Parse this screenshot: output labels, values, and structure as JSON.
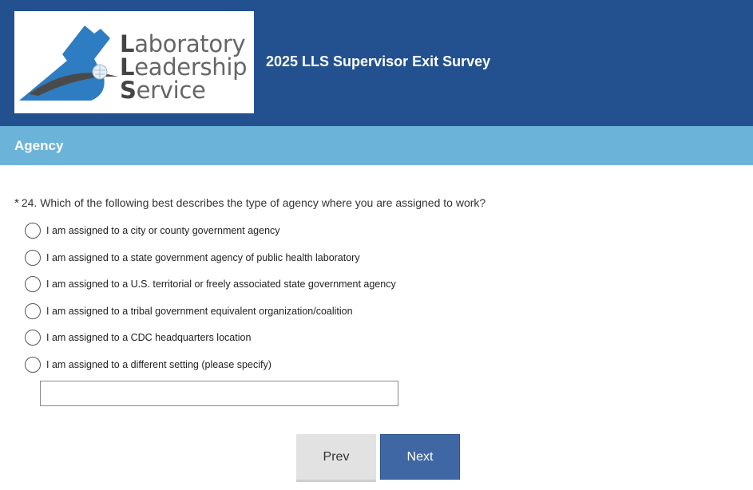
{
  "header": {
    "logo": {
      "line1_initial": "L",
      "line1_rest": "aboratory",
      "line2_initial": "L",
      "line2_rest": "eadership",
      "line3_initial": "S",
      "line3_rest": "ervice"
    },
    "survey_title": "2025 LLS Supervisor Exit Survey",
    "background_color": "#23518f"
  },
  "section": {
    "title": "Agency",
    "background_color": "#6cb3da"
  },
  "question": {
    "required_marker": "*",
    "text": "24. Which of the following best describes the type of agency where you are assigned to work?",
    "options": [
      {
        "label": "I am assigned to a city or county government agency",
        "selected": false
      },
      {
        "label": "I am assigned to a state government agency of public health laboratory",
        "selected": false
      },
      {
        "label": "I am assigned to a U.S. territorial or freely associated state government agency",
        "selected": false
      },
      {
        "label": "I am assigned to a tribal government equivalent organization/coalition",
        "selected": false
      },
      {
        "label": "I am assigned to a CDC headquarters location",
        "selected": false
      },
      {
        "label": "I am assigned to a different setting (please specify)",
        "selected": false
      }
    ],
    "other_value": "",
    "other_placeholder": ""
  },
  "navigation": {
    "prev_label": "Prev",
    "next_label": "Next",
    "next_color": "#3f67a3"
  }
}
